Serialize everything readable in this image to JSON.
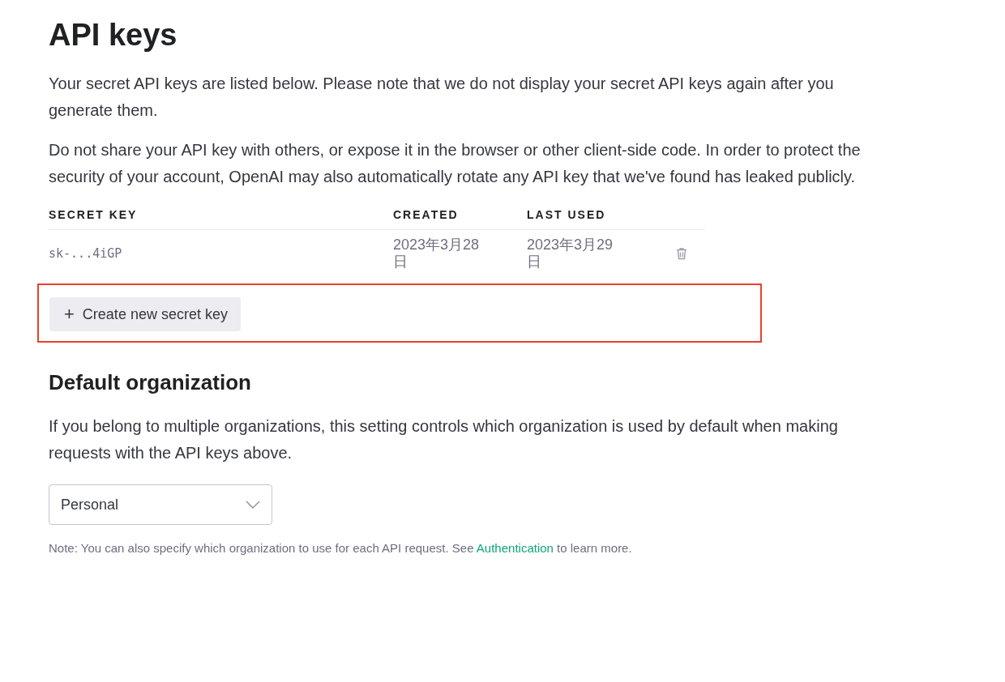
{
  "title": "API keys",
  "intro": [
    "Your secret API keys are listed below. Please note that we do not display your secret API keys again after you generate them.",
    "Do not share your API key with others, or expose it in the browser or other client-side code. In order to protect the security of your account, OpenAI may also automatically rotate any API key that we've found has leaked publicly."
  ],
  "table": {
    "columns": [
      "SECRET KEY",
      "CREATED",
      "LAST USED"
    ],
    "rows": [
      {
        "key": "sk-...4iGP",
        "created": "2023年3月28日",
        "last_used": "2023年3月29日"
      }
    ]
  },
  "create_button": {
    "icon": "+",
    "label": "Create new secret key",
    "highlighted": true
  },
  "org_section": {
    "heading": "Default organization",
    "description": "If you belong to multiple organizations, this setting controls which organization is used by default when making requests with the API keys above.",
    "select_value": "Personal",
    "note_before": "Note: You can also specify which organization to use for each API request. See ",
    "note_link": "Authentication",
    "note_after": " to learn more."
  }
}
